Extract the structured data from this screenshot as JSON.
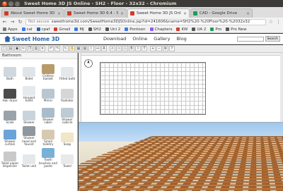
{
  "window": {
    "title": "Sweet Home 3D JS Online - SH2 - Floor - 32x32 - Chromium"
  },
  "tabs": [
    {
      "label": "About Sweet Home 3D",
      "color": "#d13c2a"
    },
    {
      "label": "Sweet Home 3D 6.4 - Sw",
      "color": "#d13c2a"
    },
    {
      "label": "Sweet Home 3D JS Online",
      "color": "#d13c2a"
    },
    {
      "label": "CAD - Google Drive",
      "color": "#1a9e5a"
    }
  ],
  "address": {
    "security": "Not secure",
    "url": "sweethome3d.com/SweetHome3DJSOnline.jsp?id=241606&name=SH2%20-%20Floor%20-%2032x32"
  },
  "bookmarks": [
    {
      "label": "Apps",
      "color": "#777"
    },
    {
      "label": "cal",
      "color": "#3b78e7"
    },
    {
      "label": "cpaf",
      "color": "#2a62a8"
    },
    {
      "label": "Gmail",
      "color": "#d13c2a"
    },
    {
      "label": "MJ",
      "color": "#3b78e7"
    },
    {
      "label": "SH2",
      "color": "#555"
    },
    {
      "label": "Uni 2",
      "color": "#555"
    },
    {
      "label": "Pontoon",
      "color": "#3b78e7"
    },
    {
      "label": "Chapters",
      "color": "#8b5cf6"
    },
    {
      "label": "KW",
      "color": "#d13c2a"
    },
    {
      "label": "UA 2",
      "color": "#555"
    },
    {
      "label": "Pro",
      "color": "#1a9e5a"
    },
    {
      "label": "Pro New",
      "color": "#555"
    }
  ],
  "site": {
    "logo": "Sweet Home 3D",
    "menu": [
      "Download",
      "Online",
      "Gallery",
      "Blog"
    ],
    "search_button": "Search"
  },
  "catalog": {
    "category": "Bathroom",
    "items": [
      {
        "label": "Bath",
        "color": "#cfd8df"
      },
      {
        "label": "Bidet",
        "color": "#dfe4e8"
      },
      {
        "label": "Clothes basket",
        "color": "#b99b6b"
      },
      {
        "label": "Fitted bath",
        "color": "#e4e8eb"
      },
      {
        "label": "Hair dryer",
        "color": "#4b4b4b"
      },
      {
        "label": "Hanged toilet",
        "color": "#e6e9ec"
      },
      {
        "label": "Mirror",
        "color": "#b8c6cf"
      },
      {
        "label": "Radiator",
        "color": "#d6d6d6"
      },
      {
        "label": "Scale",
        "color": "#9aa3aa"
      },
      {
        "label": "Shower",
        "color": "#c8d4dc"
      },
      {
        "label": "Shower cabin",
        "color": "#a8bccb"
      },
      {
        "label": "Shower cubicle",
        "color": "#bfcbd4"
      },
      {
        "label": "Shower curtain",
        "color": "#6aa3d8"
      },
      {
        "label": "Shower head and faucet",
        "color": "#8e979d"
      },
      {
        "label": "Small toiletry",
        "color": "#d7c9b0"
      },
      {
        "label": "Soap",
        "color": "#f0e6c8"
      },
      {
        "label": "Toilet paper dispenser",
        "color": "#c9c9c9"
      },
      {
        "label": "Toilet unit",
        "color": "#e4e8eb"
      },
      {
        "label": "Tooth brushes and paste",
        "color": "#79b0d8"
      },
      {
        "label": "Towel",
        "color": "#e9e9e9"
      }
    ]
  }
}
